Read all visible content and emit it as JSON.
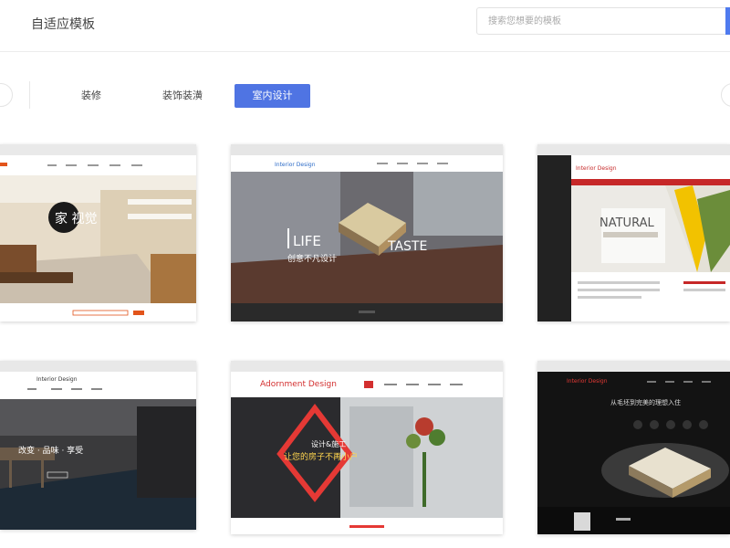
{
  "header": {
    "title": "自适应模板",
    "search_placeholder": "搜索您想要的模板"
  },
  "categories": [
    {
      "label": "装修",
      "active": false
    },
    {
      "label": "装饰装潢",
      "active": false
    },
    {
      "label": "室内设计",
      "active": true
    }
  ],
  "cards": [
    {
      "overlay_text": "家 视觉"
    },
    {
      "logo": "Interior Design",
      "left_text": "LIFE",
      "right_text": "TASTE",
      "sub_text": "创意不凡设计"
    },
    {
      "logo": "Interior Design",
      "headline": "NATURAL"
    },
    {
      "logo": "Interior Design",
      "headline": "改变 · 品味 · 享受"
    },
    {
      "logo": "Adornment Design",
      "headline": "设计&施工",
      "sub_headline": "让您的房子不再小户"
    },
    {
      "logo": "Interior Design",
      "headline": "从毛坯到完美的理想入住"
    }
  ]
}
